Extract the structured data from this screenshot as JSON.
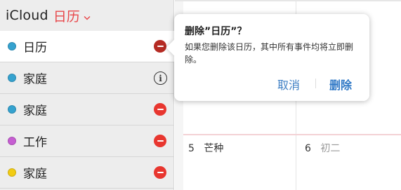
{
  "header": {
    "app_name": "iCloud",
    "calendar_title": "日历",
    "accent_color": "#e8474a"
  },
  "calendars": [
    {
      "label": "日历",
      "color": "#35a2cf",
      "action": "delete",
      "selected": true
    },
    {
      "label": "家庭",
      "color": "#35a2cf",
      "action": "info",
      "selected": false
    },
    {
      "label": "家庭",
      "color": "#35a2cf",
      "action": "delete",
      "selected": false
    },
    {
      "label": "工作",
      "color": "#c65ed2",
      "action": "delete",
      "selected": false
    },
    {
      "label": "家庭",
      "color": "#f2cc13",
      "action": "delete",
      "selected": false
    }
  ],
  "calendar_grid": {
    "days": [
      {
        "number": "5",
        "lunar": "芒种"
      },
      {
        "number": "6",
        "lunar": "初二"
      }
    ]
  },
  "popover": {
    "title": "删除”日历”？",
    "message": "如果您删除该日历，其中所有事件均将立即删除。",
    "cancel_label": "取消",
    "delete_label": "删除"
  },
  "icons": {
    "chevron": "chevron-down-icon",
    "delete": "delete-minus-icon",
    "info": "info-icon"
  }
}
